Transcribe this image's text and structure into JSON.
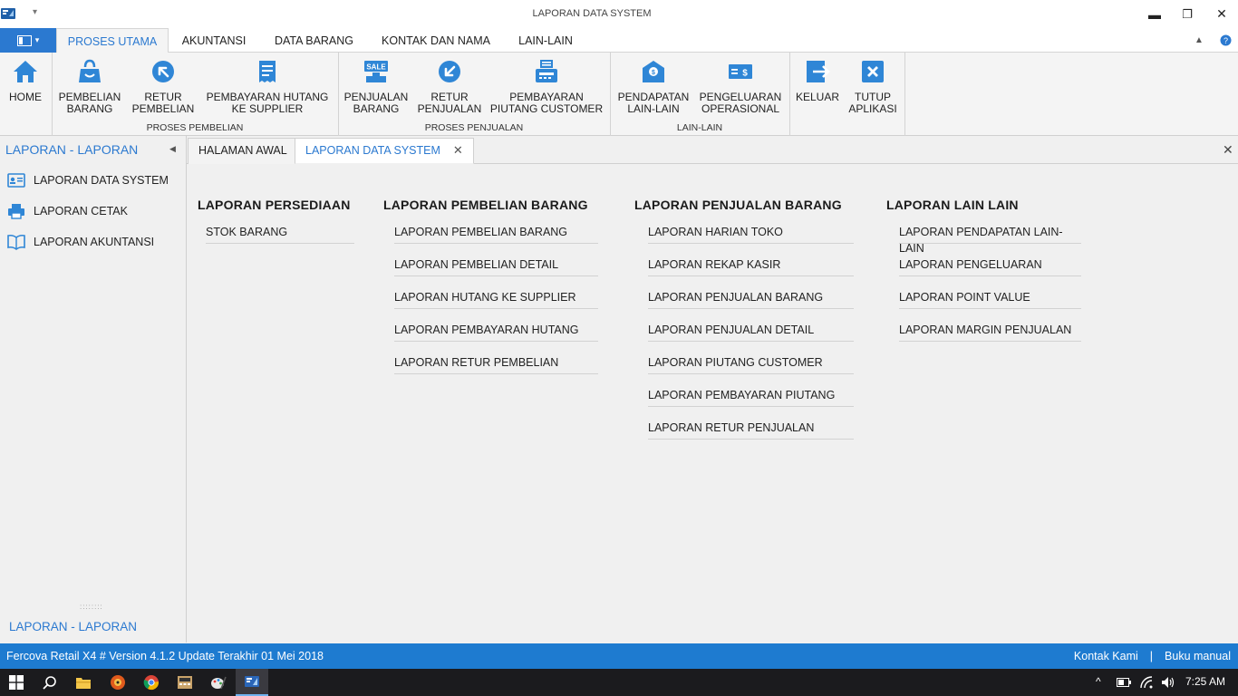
{
  "window": {
    "title": "LAPORAN DATA SYSTEM",
    "controls": {
      "minimize": "▬",
      "restore": "❐",
      "close": "✕"
    }
  },
  "ribbon_tabs": [
    "PROSES UTAMA",
    "AKUNTANSI",
    "DATA BARANG",
    "KONTAK DAN NAMA",
    "LAIN-LAIN"
  ],
  "ribbon": {
    "buttons": [
      {
        "label": "HOME",
        "icon": "home-icon"
      },
      {
        "label": "PEMBELIAN\nBARANG",
        "icon": "shopping-bag-icon"
      },
      {
        "label": "RETUR\nPEMBELIAN",
        "icon": "arrow-up-left-icon"
      },
      {
        "label": "PEMBAYARAN HUTANG\nKE SUPPLIER",
        "icon": "invoice-icon"
      },
      {
        "label": "PENJUALAN\nBARANG",
        "icon": "sale-tag-icon"
      },
      {
        "label": "RETUR\nPENJUALAN",
        "icon": "arrow-down-left-icon"
      },
      {
        "label": "PEMBAYARAN\nPIUTANG CUSTOMER",
        "icon": "fax-icon"
      },
      {
        "label": "PENDAPATAN\nLAIN-LAIN",
        "icon": "money-box-icon"
      },
      {
        "label": "PENGELUARAN\nOPERASIONAL",
        "icon": "cash-icon"
      },
      {
        "label": "KELUAR",
        "icon": "logout-icon"
      },
      {
        "label": "TUTUP\nAPLIKASI",
        "icon": "close-box-icon"
      }
    ],
    "groups": [
      "PROSES PEMBELIAN",
      "PROSES PENJUALAN",
      "LAIN-LAIN"
    ]
  },
  "nav": {
    "header": "LAPORAN - LAPORAN",
    "items": [
      "LAPORAN DATA SYSTEM",
      "LAPORAN CETAK",
      "LAPORAN AKUNTANSI"
    ],
    "footer": "LAPORAN - LAPORAN"
  },
  "doc_tabs": [
    "HALAMAN AWAL",
    "LAPORAN DATA SYSTEM"
  ],
  "report_columns": [
    {
      "heading": "LAPORAN PERSEDIAAN",
      "items": [
        "STOK BARANG"
      ]
    },
    {
      "heading": "LAPORAN PEMBELIAN BARANG",
      "items": [
        "LAPORAN PEMBELIAN BARANG",
        "LAPORAN PEMBELIAN DETAIL",
        "LAPORAN HUTANG KE SUPPLIER",
        "LAPORAN PEMBAYARAN  HUTANG",
        "LAPORAN RETUR PEMBELIAN"
      ]
    },
    {
      "heading": "LAPORAN PENJUALAN BARANG",
      "items": [
        "LAPORAN HARIAN TOKO",
        "LAPORAN REKAP KASIR",
        "LAPORAN PENJUALAN BARANG",
        "LAPORAN PENJUALAN DETAIL",
        "LAPORAN PIUTANG CUSTOMER",
        "LAPORAN PEMBAYARAN  PIUTANG",
        "LAPORAN RETUR PENJUALAN"
      ]
    },
    {
      "heading": "LAPORAN LAIN LAIN",
      "items": [
        "LAPORAN PENDAPATAN LAIN-LAIN",
        "LAPORAN PENGELUARAN",
        "LAPORAN POINT VALUE",
        "LAPORAN MARGIN PENJUALAN"
      ]
    }
  ],
  "status": {
    "version": "Fercova Retail X4 # Version 4.1.2 Update Terakhir 01 Mei 2018",
    "contact": "Kontak Kami",
    "separator": "|",
    "manual": "Buku manual"
  },
  "taskbar": {
    "time": "7:25 AM",
    "apps": [
      "start-icon",
      "search-icon",
      "file-explorer-icon",
      "media-player-icon",
      "chrome-icon",
      "calculator-icon",
      "paint-icon",
      "fercova-app-icon"
    ]
  },
  "colors": {
    "accent": "#2b79d0",
    "statusbar": "#1e7bd0",
    "taskbar": "#1b1b1e"
  }
}
